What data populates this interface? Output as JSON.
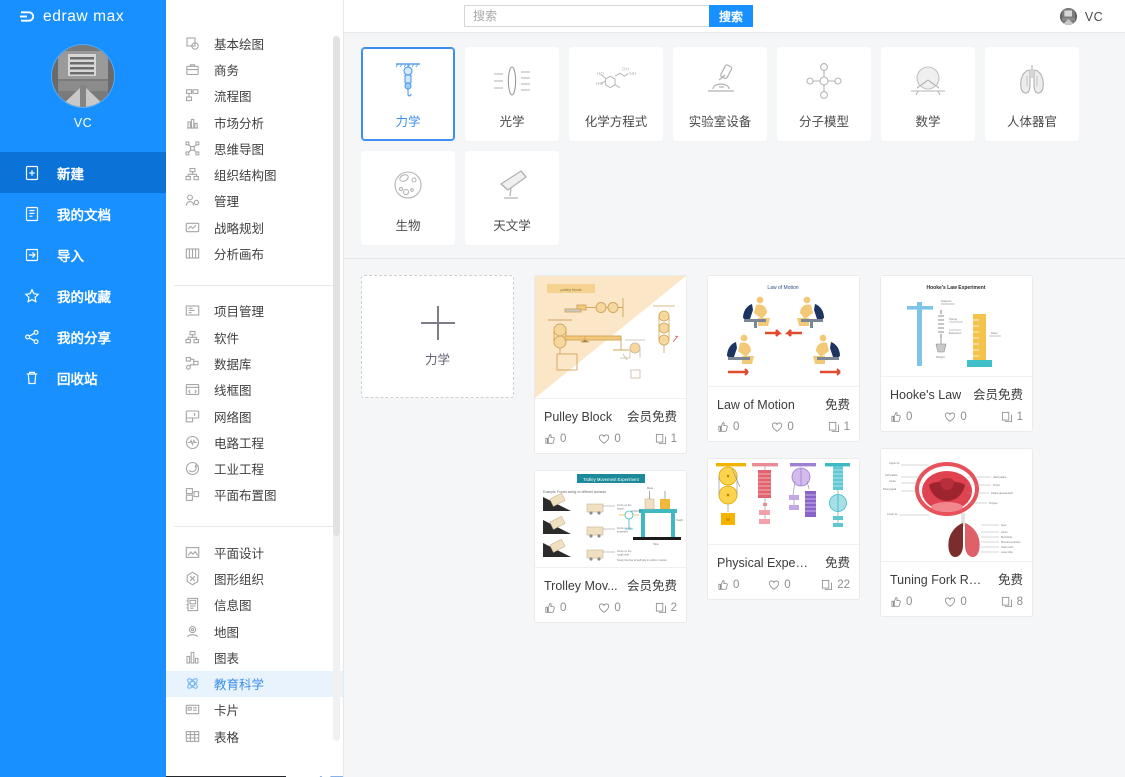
{
  "brand": {
    "name": "edraw max"
  },
  "sidebar": {
    "profile_name": "VC",
    "items": [
      {
        "label": "新建",
        "icon": "new-file-icon",
        "active": true
      },
      {
        "label": "我的文档",
        "icon": "documents-icon",
        "active": false
      },
      {
        "label": "导入",
        "icon": "import-icon",
        "active": false
      },
      {
        "label": "我的收藏",
        "icon": "star-icon",
        "active": false
      },
      {
        "label": "我的分享",
        "icon": "share-icon",
        "active": false
      },
      {
        "label": "回收站",
        "icon": "trash-icon",
        "active": false
      }
    ]
  },
  "categories": {
    "groups": [
      {
        "items": [
          {
            "label": "基本绘图",
            "icon": "basic-shapes-icon"
          },
          {
            "label": "商务",
            "icon": "briefcase-icon"
          },
          {
            "label": "流程图",
            "icon": "flowchart-icon"
          },
          {
            "label": "市场分析",
            "icon": "market-analysis-icon"
          },
          {
            "label": "思维导图",
            "icon": "mindmap-icon"
          },
          {
            "label": "组织结构图",
            "icon": "org-chart-icon"
          },
          {
            "label": "管理",
            "icon": "management-icon"
          },
          {
            "label": "战略规划",
            "icon": "strategy-icon"
          },
          {
            "label": "分析画布",
            "icon": "canvas-icon"
          }
        ]
      },
      {
        "items": [
          {
            "label": "项目管理",
            "icon": "project-icon"
          },
          {
            "label": "软件",
            "icon": "software-icon"
          },
          {
            "label": "数据库",
            "icon": "database-icon"
          },
          {
            "label": "线框图",
            "icon": "wireframe-icon"
          },
          {
            "label": "网络图",
            "icon": "network-icon"
          },
          {
            "label": "电路工程",
            "icon": "circuit-icon"
          },
          {
            "label": "工业工程",
            "icon": "industrial-icon"
          },
          {
            "label": "平面布置图",
            "icon": "floorplan-icon"
          }
        ]
      },
      {
        "items": [
          {
            "label": "平面设计",
            "icon": "graphic-design-icon"
          },
          {
            "label": "图形组织",
            "icon": "graphic-organizer-icon"
          },
          {
            "label": "信息图",
            "icon": "infographic-icon"
          },
          {
            "label": "地图",
            "icon": "map-icon"
          },
          {
            "label": "图表",
            "icon": "chart-icon"
          },
          {
            "label": "教育科学",
            "icon": "science-icon",
            "active": true
          },
          {
            "label": "卡片",
            "icon": "card-icon"
          },
          {
            "label": "表格",
            "icon": "table-icon"
          }
        ]
      }
    ]
  },
  "search": {
    "placeholder": "搜索",
    "value": "",
    "button_label": "搜索"
  },
  "user": {
    "name": "VC"
  },
  "subcategories": {
    "row1": [
      {
        "label": "力学",
        "icon": "mechanics-icon",
        "selected": true
      },
      {
        "label": "光学",
        "icon": "optics-icon",
        "selected": false
      },
      {
        "label": "化学方程式",
        "icon": "chemistry-icon",
        "selected": false
      },
      {
        "label": "实验室设备",
        "icon": "lab-equipment-icon",
        "selected": false
      },
      {
        "label": "分子模型",
        "icon": "molecule-icon",
        "selected": false
      },
      {
        "label": "数学",
        "icon": "math-icon",
        "selected": false
      },
      {
        "label": "人体器官",
        "icon": "organs-icon",
        "selected": false
      }
    ],
    "row2": [
      {
        "label": "生物",
        "icon": "biology-icon",
        "selected": false
      },
      {
        "label": "天文学",
        "icon": "astronomy-icon",
        "selected": false
      }
    ]
  },
  "gallery": {
    "new_card": {
      "label": "力学"
    },
    "cards": [
      {
        "title": "Trolley Mov...",
        "price": "会员免费",
        "likes": "0",
        "favorites": "0",
        "copies": "2",
        "thumb": "trolley",
        "col": 2
      },
      {
        "title": "Law of Motion",
        "price": "免费",
        "likes": "0",
        "favorites": "0",
        "copies": "1",
        "thumb": "motion",
        "col": 2
      },
      {
        "title": "Physical Experi...",
        "price": "免费",
        "likes": "0",
        "favorites": "0",
        "copies": "22",
        "thumb": "pulleys",
        "col": 3
      },
      {
        "title": "Hooke's Law",
        "price": "会员免费",
        "likes": "0",
        "favorites": "0",
        "copies": "1",
        "thumb": "hooke",
        "col": 3
      },
      {
        "title": "Tuning Fork Res...",
        "price": "免费",
        "likes": "0",
        "favorites": "0",
        "copies": "8",
        "thumb": "anatomy",
        "col": 4
      },
      {
        "title": "Pulley Block",
        "price": "会员免费",
        "likes": "0",
        "favorites": "0",
        "copies": "1",
        "thumb": "pulleyblock",
        "col": 1
      }
    ]
  },
  "colors": {
    "sidebar_blue": "#1890ff",
    "sidebar_active": "#0b72d8",
    "accent": "#3d8ef0",
    "page_bg": "#f5f6f7"
  }
}
